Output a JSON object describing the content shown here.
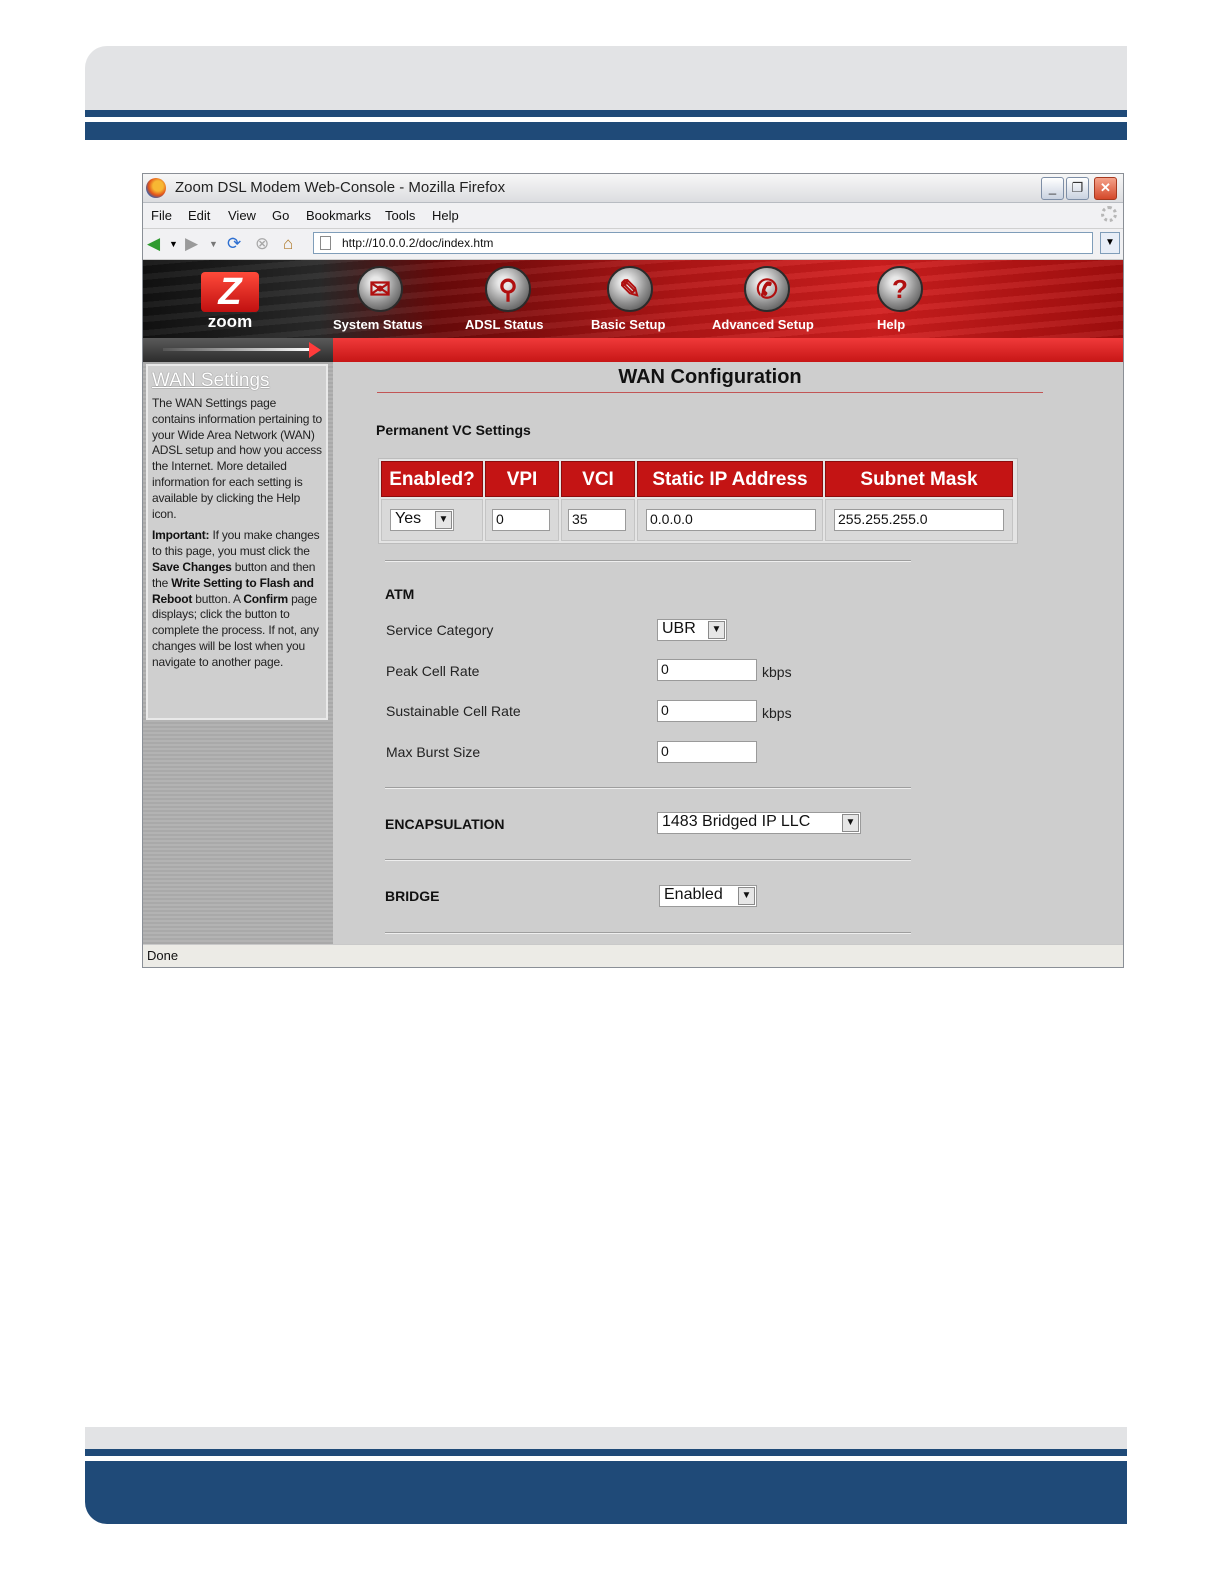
{
  "window": {
    "title": "Zoom DSL Modem Web-Console - Mozilla Firefox",
    "controls": {
      "minimize": "_",
      "restore": "❐",
      "close": "✕"
    }
  },
  "menu": [
    "File",
    "Edit",
    "View",
    "Go",
    "Bookmarks",
    "Tools",
    "Help"
  ],
  "navigation": {
    "url": "http://10.0.0.2/doc/index.htm"
  },
  "logo": {
    "mark": "Z",
    "word": "zoom"
  },
  "tabs": [
    {
      "label": "System Status",
      "icon": "folder-icon",
      "glyph": "✉"
    },
    {
      "label": "ADSL Status",
      "icon": "magnifier-icon",
      "glyph": "⚲"
    },
    {
      "label": "Basic Setup",
      "icon": "plug-icon",
      "glyph": "✎"
    },
    {
      "label": "Advanced Setup",
      "icon": "wrench-icon",
      "glyph": "✆"
    },
    {
      "label": "Help",
      "icon": "question-icon",
      "glyph": "?"
    }
  ],
  "sidebar": {
    "title": "WAN Settings",
    "intro": "The WAN Settings page contains information pertaining to your Wide Area Network (WAN) ADSL setup and how you access the Internet. More detailed information for each setting is available by clicking the Help icon.",
    "important_label": "Important:",
    "important_1": " If you make changes to this page, you must click the ",
    "save_changes": "Save Changes",
    "important_2": " button and then the ",
    "write_setting": "Write Setting to Flash and Reboot",
    "important_3": " button. A ",
    "confirm": "Confirm",
    "important_4": " page displays; click the button to complete the process. If not, any changes will be lost when you navigate to another page."
  },
  "main": {
    "title": "WAN Configuration",
    "pvc_label": "Permanent VC Settings",
    "pvc_headers": [
      "Enabled?",
      "VPI",
      "VCI",
      "Static IP Address",
      "Subnet Mask"
    ],
    "pvc_values": {
      "enabled": "Yes",
      "vpi": "0",
      "vci": "35",
      "static_ip": "0.0.0.0",
      "subnet_mask": "255.255.255.0"
    },
    "atm": {
      "label": "ATM",
      "service_category_label": "Service Category",
      "service_category": "UBR",
      "peak_cell_rate_label": "Peak Cell Rate",
      "peak_cell_rate": "0",
      "sustainable_cell_rate_label": "Sustainable Cell Rate",
      "sustainable_cell_rate": "0",
      "max_burst_size_label": "Max Burst Size",
      "max_burst_size": "0",
      "unit": "kbps"
    },
    "encapsulation": {
      "label": "ENCAPSULATION",
      "value": "1483 Bridged IP LLC"
    },
    "bridge": {
      "label": "BRIDGE",
      "value": "Enabled"
    }
  },
  "status": "Done",
  "colors": {
    "brand_red": "#c41414",
    "manual_blue": "#1f4a78",
    "manual_grey": "#e2e3e5"
  }
}
